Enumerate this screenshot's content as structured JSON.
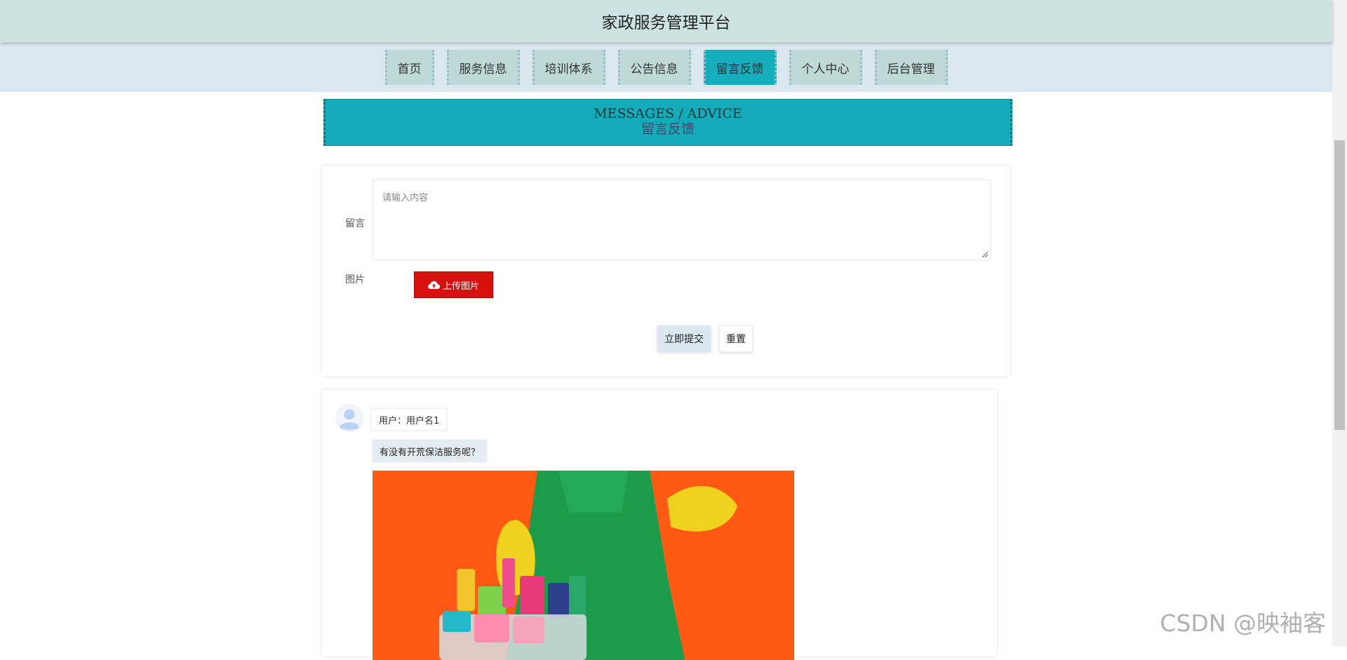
{
  "header": {
    "title": "家政服务管理平台"
  },
  "nav": {
    "items": [
      {
        "label": "首页"
      },
      {
        "label": "服务信息"
      },
      {
        "label": "培训体系"
      },
      {
        "label": "公告信息"
      },
      {
        "label": "留言反馈",
        "active": true
      },
      {
        "label": "个人中心"
      },
      {
        "label": "后台管理"
      }
    ]
  },
  "banner": {
    "title_en": "MESSAGES / ADVICE",
    "title_cn": "留言反馈"
  },
  "form": {
    "message_label": "留言",
    "message_placeholder": "请输入内容",
    "image_label": "图片",
    "upload_label": "上传图片",
    "submit_label": "立即提交",
    "reset_label": "重置"
  },
  "comments": [
    {
      "user": "用户：用户名1",
      "content": "有没有开荒保洁服务呢？"
    }
  ],
  "watermark": "CSDN @映袖客",
  "colors": {
    "accent": "#14abba",
    "upload": "#d60f0f",
    "header_bg": "#cde3e3"
  }
}
